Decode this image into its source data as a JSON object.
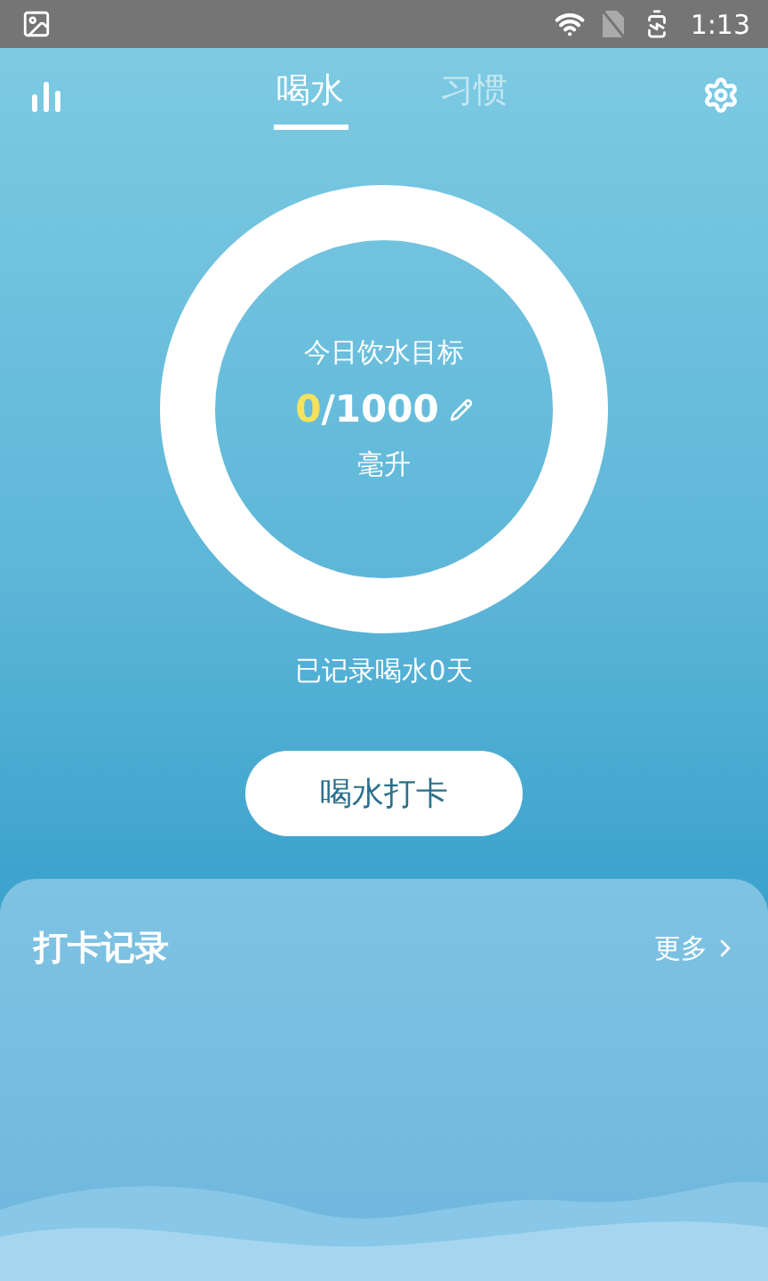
{
  "status_bar": {
    "time": "1:13"
  },
  "tabs": [
    {
      "label": "喝水",
      "selected": true
    },
    {
      "label": "习惯",
      "selected": false
    }
  ],
  "goal": {
    "title": "今日饮水目标",
    "intake": "0",
    "total": "/1000",
    "unit": "毫升"
  },
  "record_days": "已记录喝水0天",
  "checkin_button": "喝水打卡",
  "records": {
    "title": "打卡记录",
    "more": "更多"
  }
}
